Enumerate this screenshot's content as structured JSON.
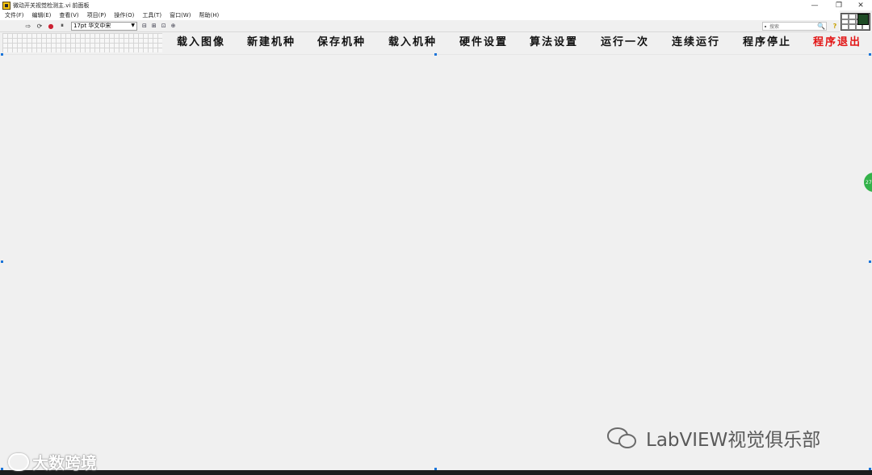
{
  "window": {
    "title": "微动开关视觉检测主.vi 前面板",
    "controls": {
      "minimize": "—",
      "restore": "❐",
      "close": "✕"
    }
  },
  "menubar": {
    "items": [
      {
        "label": "文件(F)"
      },
      {
        "label": "编辑(E)"
      },
      {
        "label": "查看(V)"
      },
      {
        "label": "项目(P)"
      },
      {
        "label": "操作(O)"
      },
      {
        "label": "工具(T)"
      },
      {
        "label": "窗口(W)"
      },
      {
        "label": "帮助(H)"
      }
    ]
  },
  "toolbar": {
    "run_icon": "⇨",
    "run_continuous_icon": "⟳",
    "abort_icon": "●",
    "pause_icon": "⏸",
    "font_selector": "17pt 华文中宋",
    "align_icon": "⊟",
    "distribute_icon": "⊞",
    "resize_icon": "⊡",
    "reorder_icon": "⊕"
  },
  "search": {
    "placeholder": "搜索",
    "search_icon": "🔍",
    "help_icon": "?"
  },
  "buttons": [
    {
      "label": "载入图像"
    },
    {
      "label": "新建机种"
    },
    {
      "label": "保存机种"
    },
    {
      "label": "载入机种"
    },
    {
      "label": "硬件设置"
    },
    {
      "label": "算法设置"
    },
    {
      "label": "运行一次"
    },
    {
      "label": "连续运行"
    },
    {
      "label": "程序停止"
    },
    {
      "label": "程序退出"
    }
  ],
  "colors": {
    "panel_bg": "#f0f0f0",
    "exit_button": "#e21414",
    "selection_handle": "#1a74d9"
  },
  "scroll_badge": "27",
  "watermarks": {
    "left": "大数跨境",
    "right": "LabVIEW视觉俱乐部"
  }
}
